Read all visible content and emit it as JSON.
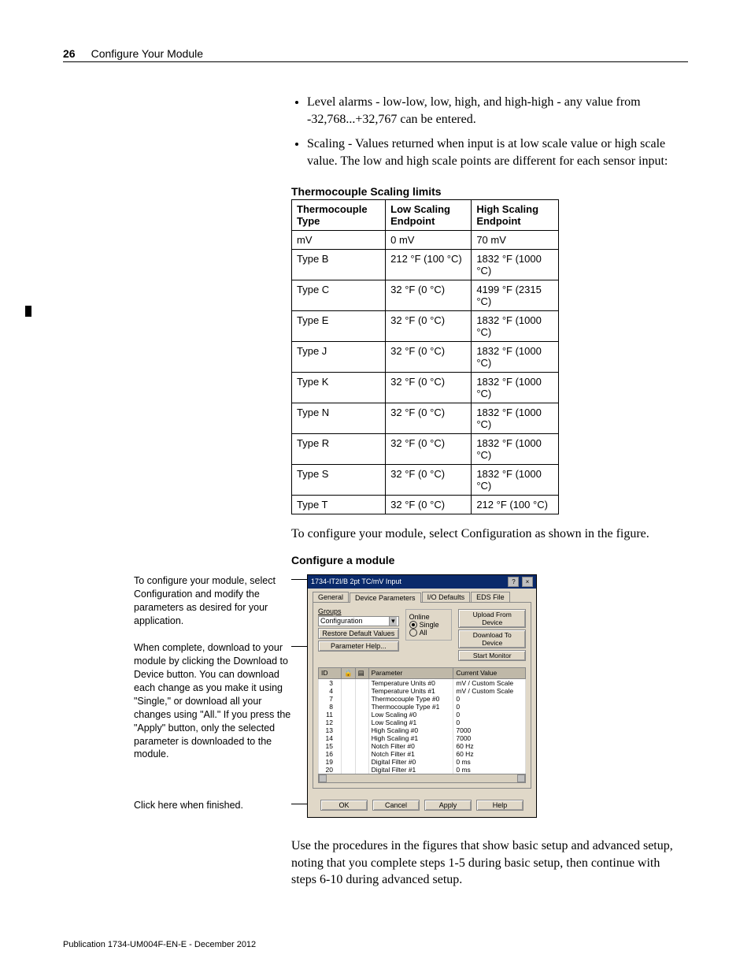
{
  "header": {
    "page_number": "26",
    "title": "Configure Your Module"
  },
  "bullets": [
    "Level alarms - low-low, low, high, and high-high - any value from -32,768...+32,767 can be entered.",
    "Scaling - Values returned when input is at low scale value or high scale value. The low and high scale points are different for each sensor input:"
  ],
  "table_title": "Thermocouple Scaling limits",
  "table_headers": [
    "Thermocouple Type",
    "Low Scaling Endpoint",
    "High Scaling Endpoint"
  ],
  "table_rows": [
    [
      "mV",
      "0 mV",
      "70 mV"
    ],
    [
      "Type B",
      "212 °F (100 °C)",
      "1832 °F (1000 °C)"
    ],
    [
      "Type C",
      "32 °F (0 °C)",
      "4199 °F (2315 °C)"
    ],
    [
      "Type E",
      "32 °F (0 °C)",
      "1832 °F (1000 °C)"
    ],
    [
      "Type J",
      "32 °F (0 °C)",
      "1832 °F (1000 °C)"
    ],
    [
      "Type K",
      "32 °F (0 °C)",
      "1832 °F (1000 °C)"
    ],
    [
      "Type N",
      "32 °F (0 °C)",
      "1832 °F (1000 °C)"
    ],
    [
      "Type R",
      "32 °F (0 °C)",
      "1832 °F (1000 °C)"
    ],
    [
      "Type S",
      "32 °F (0 °C)",
      "1832 °F (1000 °C)"
    ],
    [
      "Type T",
      "32 °F (0 °C)",
      "212 °F (100 °C)"
    ]
  ],
  "mid_text": "To configure your module, select Configuration as shown in the figure.",
  "figure_title": "Configure a module",
  "side_notes": {
    "note1": "To configure your module, select Configuration and modify the parameters as desired for your application.",
    "note2": "When complete, download to your module by clicking the Download to Device button. You can download each change as you make it using \"Single,\" or download all your changes using \"All.\" If you press the \"Apply\" button, only the selected parameter is downloaded to the module.",
    "note3": "Click here when finished."
  },
  "dialog": {
    "title": "1734-IT2I/B 2pt TC/mV Input",
    "tabs": [
      "General",
      "Device Parameters",
      "I/O Defaults",
      "EDS File"
    ],
    "groups_label": "Groups",
    "groups_value": "Configuration",
    "restore_btn": "Restore Default Values",
    "param_help_btn": "Parameter Help...",
    "online_label": "Online",
    "radio_single": "Single",
    "radio_all": "All",
    "upload_btn": "Upload From Device",
    "download_btn": "Download To Device",
    "start_btn": "Start Monitor",
    "param_headers": [
      "ID",
      "",
      "",
      "Parameter",
      "Current Value"
    ],
    "params": [
      {
        "id": "3",
        "name": "Temperature Units #0",
        "val": "mV / Custom Scale"
      },
      {
        "id": "4",
        "name": "Temperature Units #1",
        "val": "mV / Custom Scale"
      },
      {
        "id": "7",
        "name": "Thermocouple Type #0",
        "val": "0"
      },
      {
        "id": "8",
        "name": "Thermocouple Type #1",
        "val": "0"
      },
      {
        "id": "11",
        "name": "Low Scaling #0",
        "val": "0"
      },
      {
        "id": "12",
        "name": "Low Scaling #1",
        "val": "0"
      },
      {
        "id": "13",
        "name": "High Scaling #0",
        "val": "7000"
      },
      {
        "id": "14",
        "name": "High Scaling #1",
        "val": "7000"
      },
      {
        "id": "15",
        "name": "Notch Filter #0",
        "val": "60 Hz"
      },
      {
        "id": "16",
        "name": "Notch Filter #1",
        "val": "60 Hz"
      },
      {
        "id": "19",
        "name": "Digital Filter #0",
        "val": "0 ms"
      },
      {
        "id": "20",
        "name": "Digital Filter #1",
        "val": "0 ms"
      }
    ],
    "ok": "OK",
    "cancel": "Cancel",
    "apply": "Apply",
    "help": "Help"
  },
  "end_text": "Use the procedures in the figures that show basic setup and advanced setup, noting that you complete steps 1-5 during basic setup, then continue with steps 6-10 during advanced setup.",
  "footer": "Publication 1734-UM004F-EN-E - December 2012"
}
